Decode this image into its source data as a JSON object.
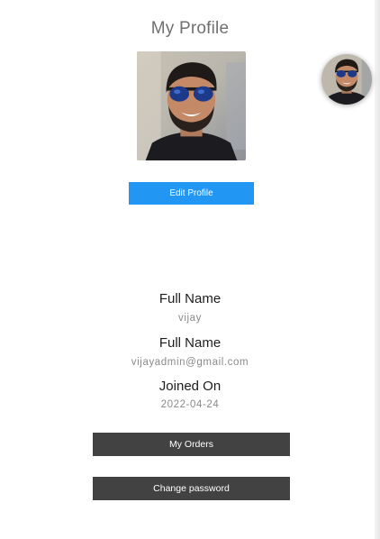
{
  "page": {
    "title": "My Profile"
  },
  "profile": {
    "photo_icon": "user-photo",
    "edit_button_label": "Edit Profile"
  },
  "header": {
    "avatar_icon": "user-avatar"
  },
  "details": [
    {
      "label": "Full Name",
      "value": "vijay"
    },
    {
      "label": "Full Name",
      "value": "vijayadmin@gmail.com"
    },
    {
      "label": "Joined On",
      "value": "2022-04-24"
    }
  ],
  "actions": {
    "orders_label": "My Orders",
    "change_password_label": "Change password"
  },
  "colors": {
    "primary_button": "#2196f3",
    "dark_button": "#424242",
    "title_text": "#707070",
    "value_text": "#8a8a8a"
  }
}
